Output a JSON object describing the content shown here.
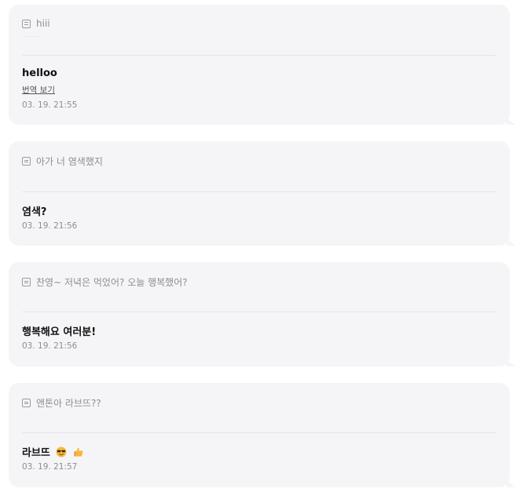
{
  "messages": [
    {
      "quote": "hiii",
      "text": "helloo",
      "translate_label": "번역 보기",
      "time": "03. 19. 21:55"
    },
    {
      "quote": "아가 너 염색했지",
      "text": "염색?",
      "time": "03. 19. 21:56"
    },
    {
      "quote": "찬영~ 저녁은 먹었어? 오늘 행복했어?",
      "text": "행복해요 여러분!",
      "time": "03. 19. 21:56"
    },
    {
      "quote": "앤톤아 라브뜨??",
      "text": "라브뜨",
      "emojis": [
        "sunglasses-face-icon",
        "thumbs-up-icon"
      ],
      "time": "03. 19. 21:57"
    }
  ]
}
